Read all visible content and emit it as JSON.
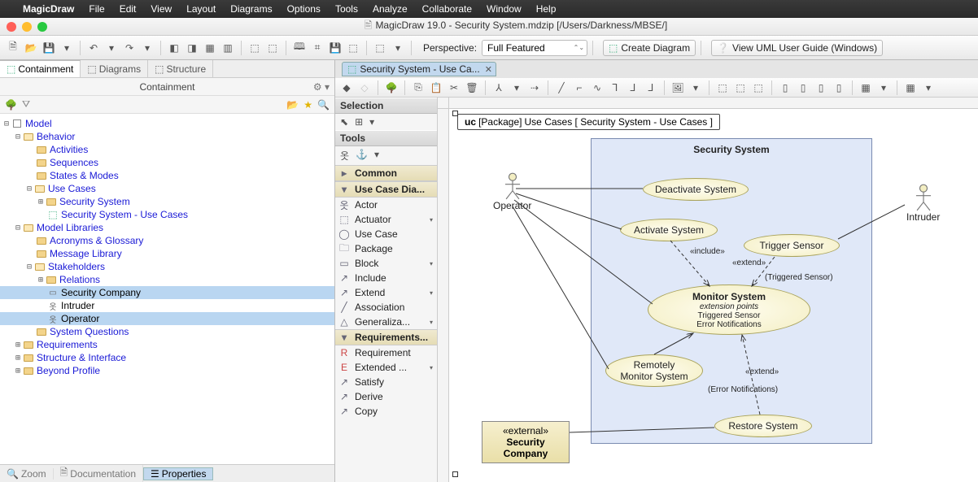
{
  "menubar": {
    "app": "MagicDraw",
    "items": [
      "File",
      "Edit",
      "View",
      "Layout",
      "Diagrams",
      "Options",
      "Tools",
      "Analyze",
      "Collaborate",
      "Window",
      "Help"
    ]
  },
  "window_title": "MagicDraw 19.0 - Security System.mdzip [/Users/Darkness/MBSE/]",
  "toolbar": {
    "perspective_label": "Perspective:",
    "perspective_value": "Full Featured",
    "create_diagram": "Create Diagram",
    "view_guide": "View UML User Guide (Windows)"
  },
  "left": {
    "tabs": {
      "containment": "Containment",
      "diagrams": "Diagrams",
      "structure": "Structure"
    },
    "title": "Containment",
    "tree": {
      "root": "Model",
      "behavior": "Behavior",
      "activities": "Activities",
      "sequences": "Sequences",
      "states": "States & Modes",
      "usecases": "Use Cases",
      "securitysystem": "Security System",
      "ssuc": "Security System - Use Cases",
      "modellib": "Model Libraries",
      "acronyms": "Acronyms & Glossary",
      "msglib": "Message Library",
      "stakeholders": "Stakeholders",
      "relations": "Relations",
      "seccompany": "Security Company",
      "intruder": "Intruder",
      "operator": "Operator",
      "sysq": "System Questions",
      "requirements": "Requirements",
      "structint": "Structure & Interface",
      "beyond": "Beyond Profile"
    },
    "bottom": {
      "zoom": "Zoom",
      "doc": "Documentation",
      "props": "Properties"
    }
  },
  "doctab": "Security System - Use Ca...",
  "palette": {
    "selection": "Selection",
    "tools": "Tools",
    "common": "Common",
    "ucd": "Use Case Dia...",
    "actor": "Actor",
    "actuator": "Actuator",
    "usecase": "Use Case",
    "package": "Package",
    "block": "Block",
    "include": "Include",
    "extend": "Extend",
    "assoc": "Association",
    "general": "Generaliza...",
    "req": "Requirements...",
    "requirement": "Requirement",
    "extended": "Extended ...",
    "satisfy": "Satisfy",
    "derive": "Derive",
    "copy": "Copy"
  },
  "diagram": {
    "frame_kind": "uc",
    "frame_type": "[Package]",
    "frame_name": "Use Cases [ Security System - Use Cases ]",
    "boundary": "Security System",
    "uc_deactivate": "Deactivate System",
    "uc_activate": "Activate System",
    "uc_trigger": "Trigger Sensor",
    "uc_monitor": "Monitor System",
    "uc_monitor_ext": "extension points",
    "uc_monitor_e1": "Triggered Sensor",
    "uc_monitor_e2": "Error Notifications",
    "uc_remote_l1": "Remotely",
    "uc_remote_l2": "Monitor System",
    "uc_restore": "Restore System",
    "actor_op": "Operator",
    "actor_in": "Intruder",
    "ext_stereo": "«external»",
    "ext_name": "Security Company",
    "lbl_include": "«include»",
    "lbl_extend1": "«extend»",
    "lbl_extend2": "«extend»",
    "lbl_trigsens": "(Triggered Sensor)",
    "lbl_errnot": "(Error Notifications)"
  }
}
